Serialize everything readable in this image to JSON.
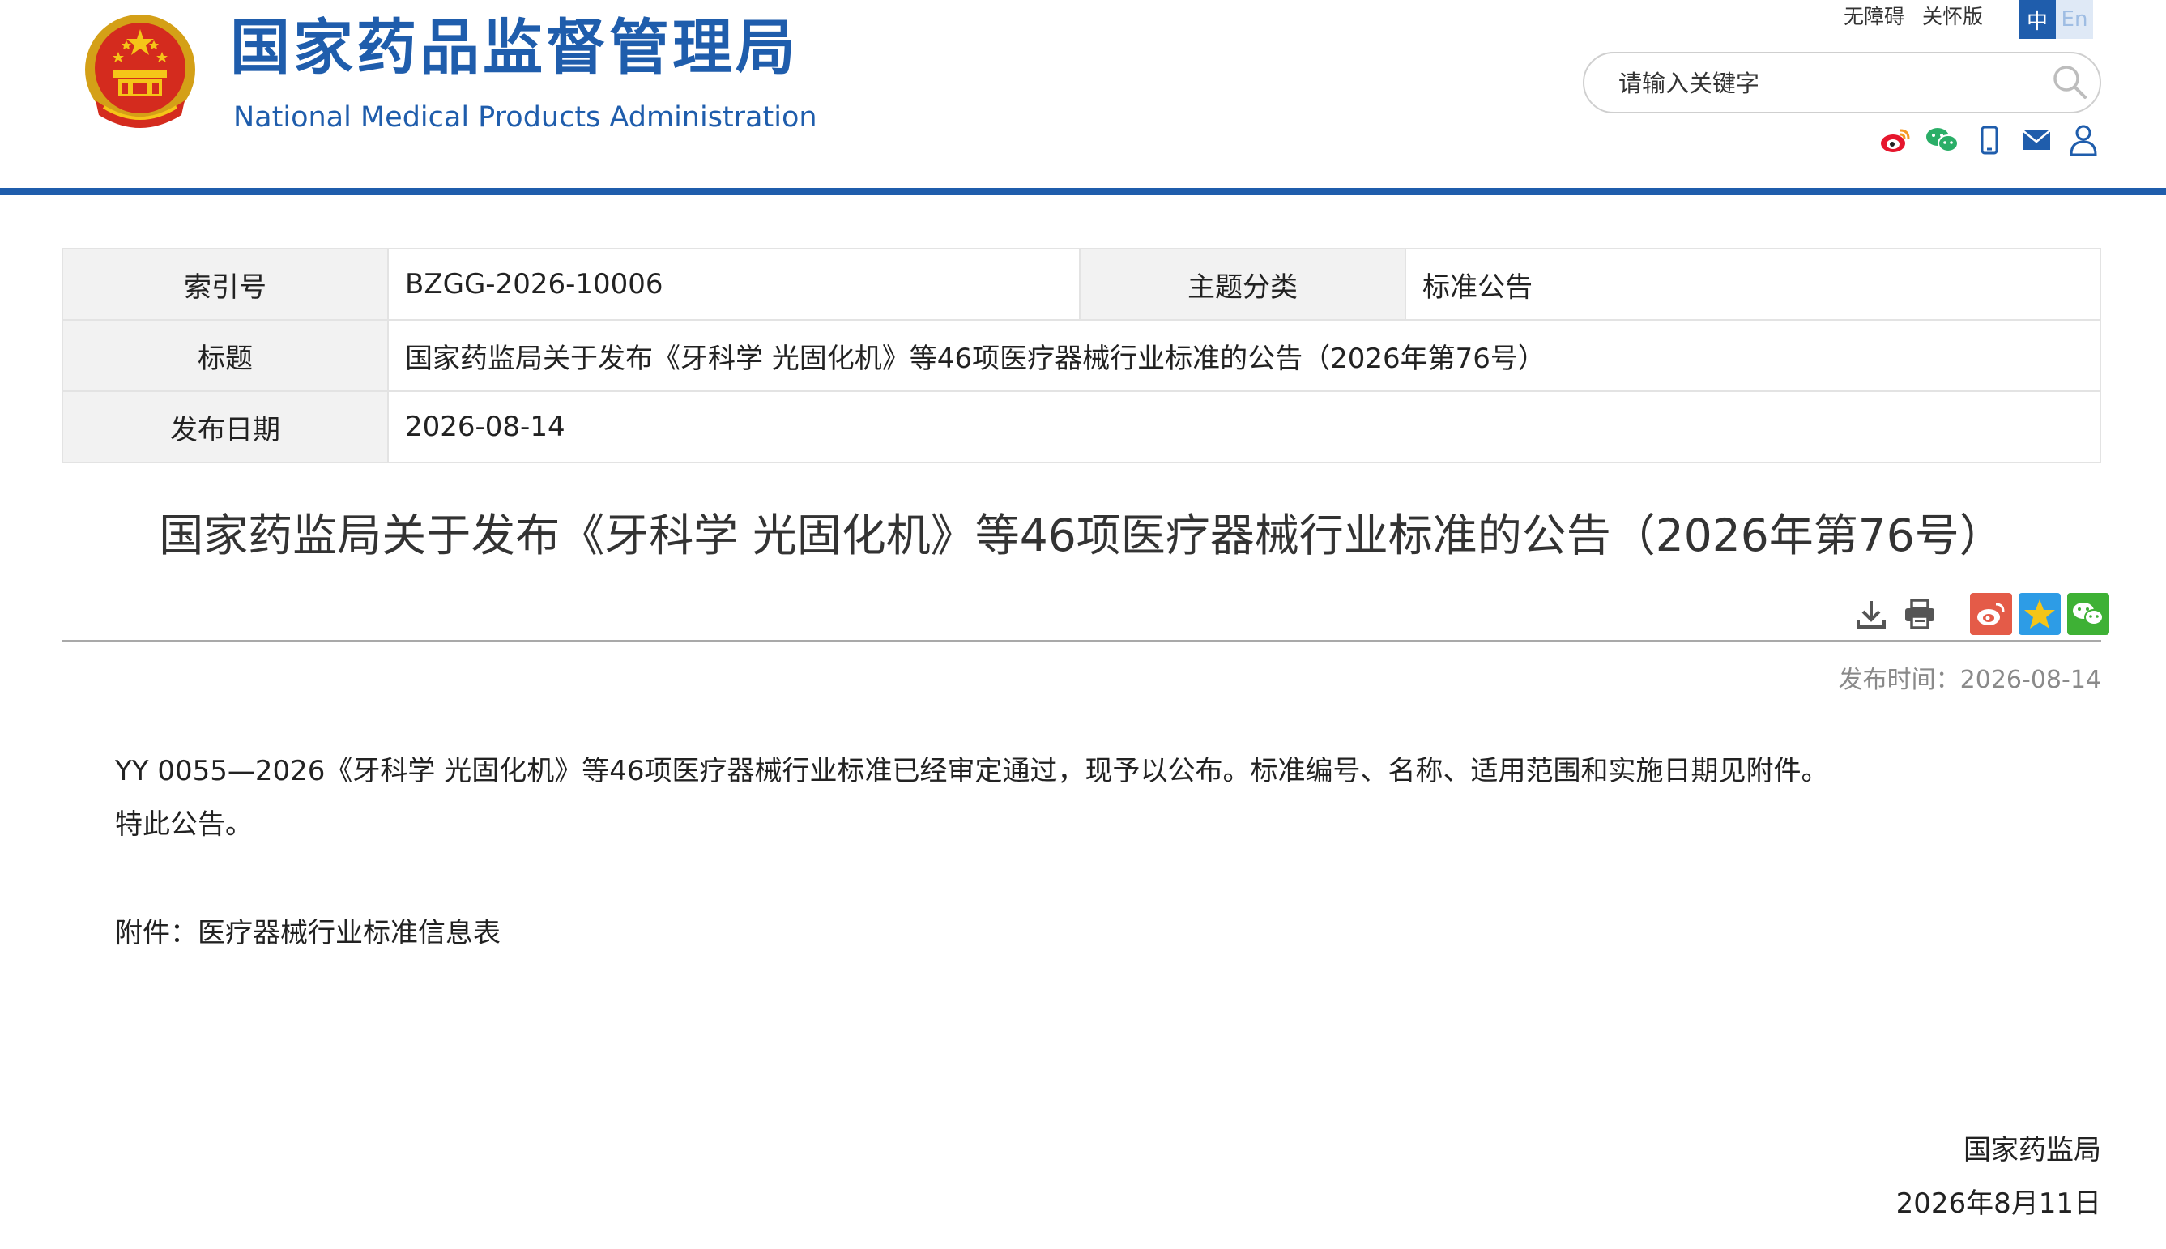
{
  "header": {
    "site_title_cn": "国家药品监督管理局",
    "site_title_en": "National Medical Products Administration",
    "links": [
      "无障碍",
      "关怀版"
    ],
    "lang": {
      "zh": "中",
      "en": "En"
    },
    "search": {
      "placeholder": "请输入关键字",
      "value": ""
    },
    "social_icons": [
      "weibo-icon",
      "wechat-icon",
      "mobile-icon",
      "mail-icon",
      "user-icon"
    ],
    "accent_color": "#1f5dac"
  },
  "info": {
    "index_label": "索引号",
    "index_value": "BZGG-2026-10006",
    "category_label": "主题分类",
    "category_value": "标准公告",
    "title_label": "标题",
    "title_value": "国家药监局关于发布《牙科学 光固化机》等46项医疗器械行业标准的公告（2026年第76号）",
    "date_label": "发布日期",
    "date_value": "2026-08-14"
  },
  "article": {
    "title": "国家药监局关于发布《牙科学 光固化机》等46项医疗器械行业标准的公告（2026年第76号）",
    "tool_icons": [
      "download-icon",
      "print-icon"
    ],
    "share_icons": [
      "weibo-share-icon",
      "qzone-share-icon",
      "wechat-share-icon"
    ],
    "publish_time_label": "发布时间：",
    "publish_time_value": "2026-08-14",
    "paragraph1": "YY 0055—2026《牙科学 光固化机》等46项医疗器械行业标准已经审定通过，现予以公布。标准编号、名称、适用范围和实施日期见附件。",
    "paragraph2": "特此公告。",
    "attachment_label": "附件：",
    "attachment_link": "医疗器械行业标准信息表",
    "signature_org": "国家药监局",
    "signature_date": "2026年8月11日"
  }
}
